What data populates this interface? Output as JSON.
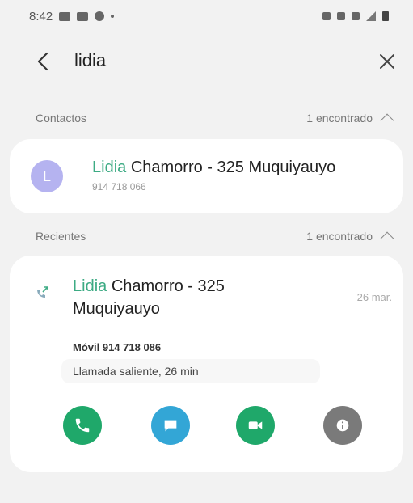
{
  "status_bar": {
    "time": "8:42"
  },
  "search": {
    "query": "lidia"
  },
  "contacts_section": {
    "label": "Contactos",
    "count": "1 encontrado"
  },
  "contact": {
    "avatar_initial": "L",
    "name_highlight": "Lidia",
    "name_rest": " Chamorro - 325 Muquiyauyo",
    "number": "914 718 066"
  },
  "recents_section": {
    "label": "Recientes",
    "count": "1 encontrado"
  },
  "recent": {
    "name_highlight": "Lidia",
    "name_rest": " Chamorro - 325 Muquiyauyo",
    "date": "26 mar.",
    "number_line": "Móvil 914 718 086",
    "detail": "Llamada saliente, 26 min"
  },
  "colors": {
    "highlight": "#3dab84",
    "call": "#1fa86a",
    "message": "#33a6d6",
    "video": "#1fa86a",
    "info": "#7a7a7a"
  },
  "icons": [
    "back-arrow-icon",
    "close-icon",
    "chevron-up-icon",
    "outgoing-call-icon",
    "phone-icon",
    "message-icon",
    "video-icon",
    "info-icon"
  ]
}
